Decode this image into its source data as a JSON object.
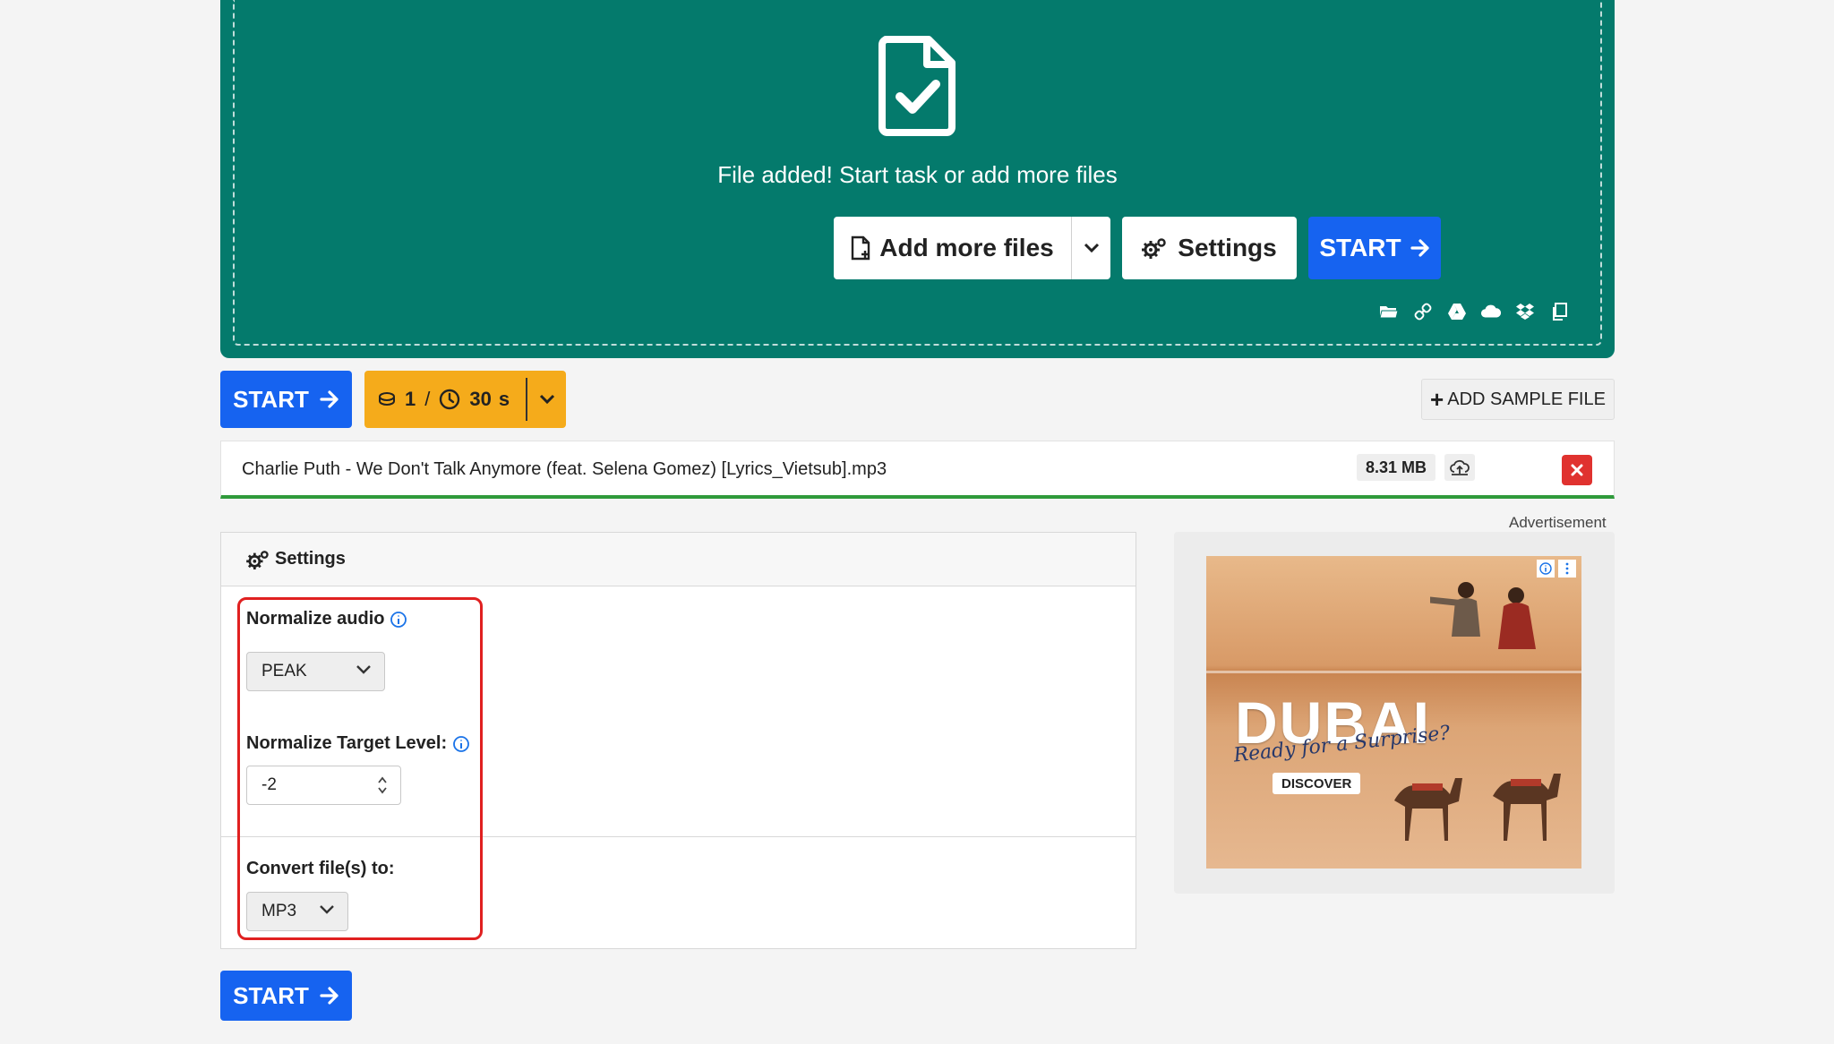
{
  "dropzone": {
    "message": "File added! Start task or add more files",
    "add_files_label": "Add more files",
    "settings_label": "Settings",
    "start_label": "START",
    "source_icons": [
      "folder-icon",
      "link-icon",
      "google-drive-icon",
      "onedrive-icon",
      "dropbox-icon",
      "clipboard-icon"
    ]
  },
  "toolbar": {
    "start_label": "START",
    "credits_count": "1",
    "credits_separator": "/",
    "time_value": "30",
    "time_unit": "s",
    "add_sample_label": "ADD SAMPLE FILE"
  },
  "file": {
    "name": "Charlie Puth - We Don't Talk Anymore (feat. Selena Gomez) [Lyrics_Vietsub].mp3",
    "size": "8.31 MB"
  },
  "settings": {
    "title": "Settings",
    "normalize_label": "Normalize audio",
    "normalize_value": "PEAK",
    "target_label": "Normalize Target Level:",
    "target_value": "-2",
    "convert_label": "Convert file(s) to:",
    "convert_value": "MP3"
  },
  "bottom": {
    "start_label": "START"
  },
  "ad": {
    "label": "Advertisement",
    "title": "DUBAI",
    "tagline": "Ready for a Surprise?",
    "cta": "DISCOVER"
  },
  "colors": {
    "dropzone_bg": "#047a6c",
    "primary": "#1663f0",
    "credits": "#f5ab1b",
    "danger": "#e0322f",
    "progress": "#2f9a3b"
  }
}
